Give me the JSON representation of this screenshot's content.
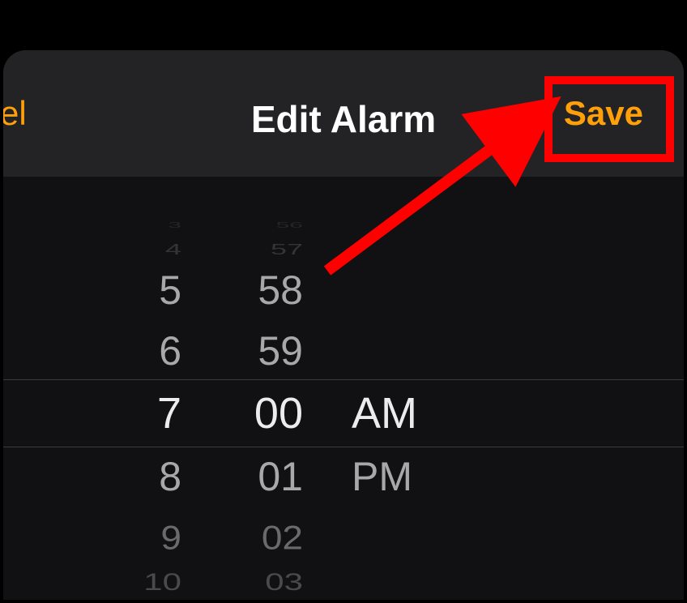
{
  "nav": {
    "cancel_label_fragment": "el",
    "title": "Edit Alarm",
    "save_label": "Save"
  },
  "picker": {
    "hours": {
      "minus4": "3",
      "minus3": "4",
      "minus2": "5",
      "minus1": "6",
      "selected": "7",
      "plus1": "8",
      "plus2": "9",
      "plus3": "10"
    },
    "minutes": {
      "minus4": "56",
      "minus3": "57",
      "minus2": "58",
      "minus1": "59",
      "selected": "00",
      "plus1": "01",
      "plus2": "02",
      "plus3": "03"
    },
    "ampm": {
      "selected": "AM",
      "plus1": "PM"
    }
  }
}
